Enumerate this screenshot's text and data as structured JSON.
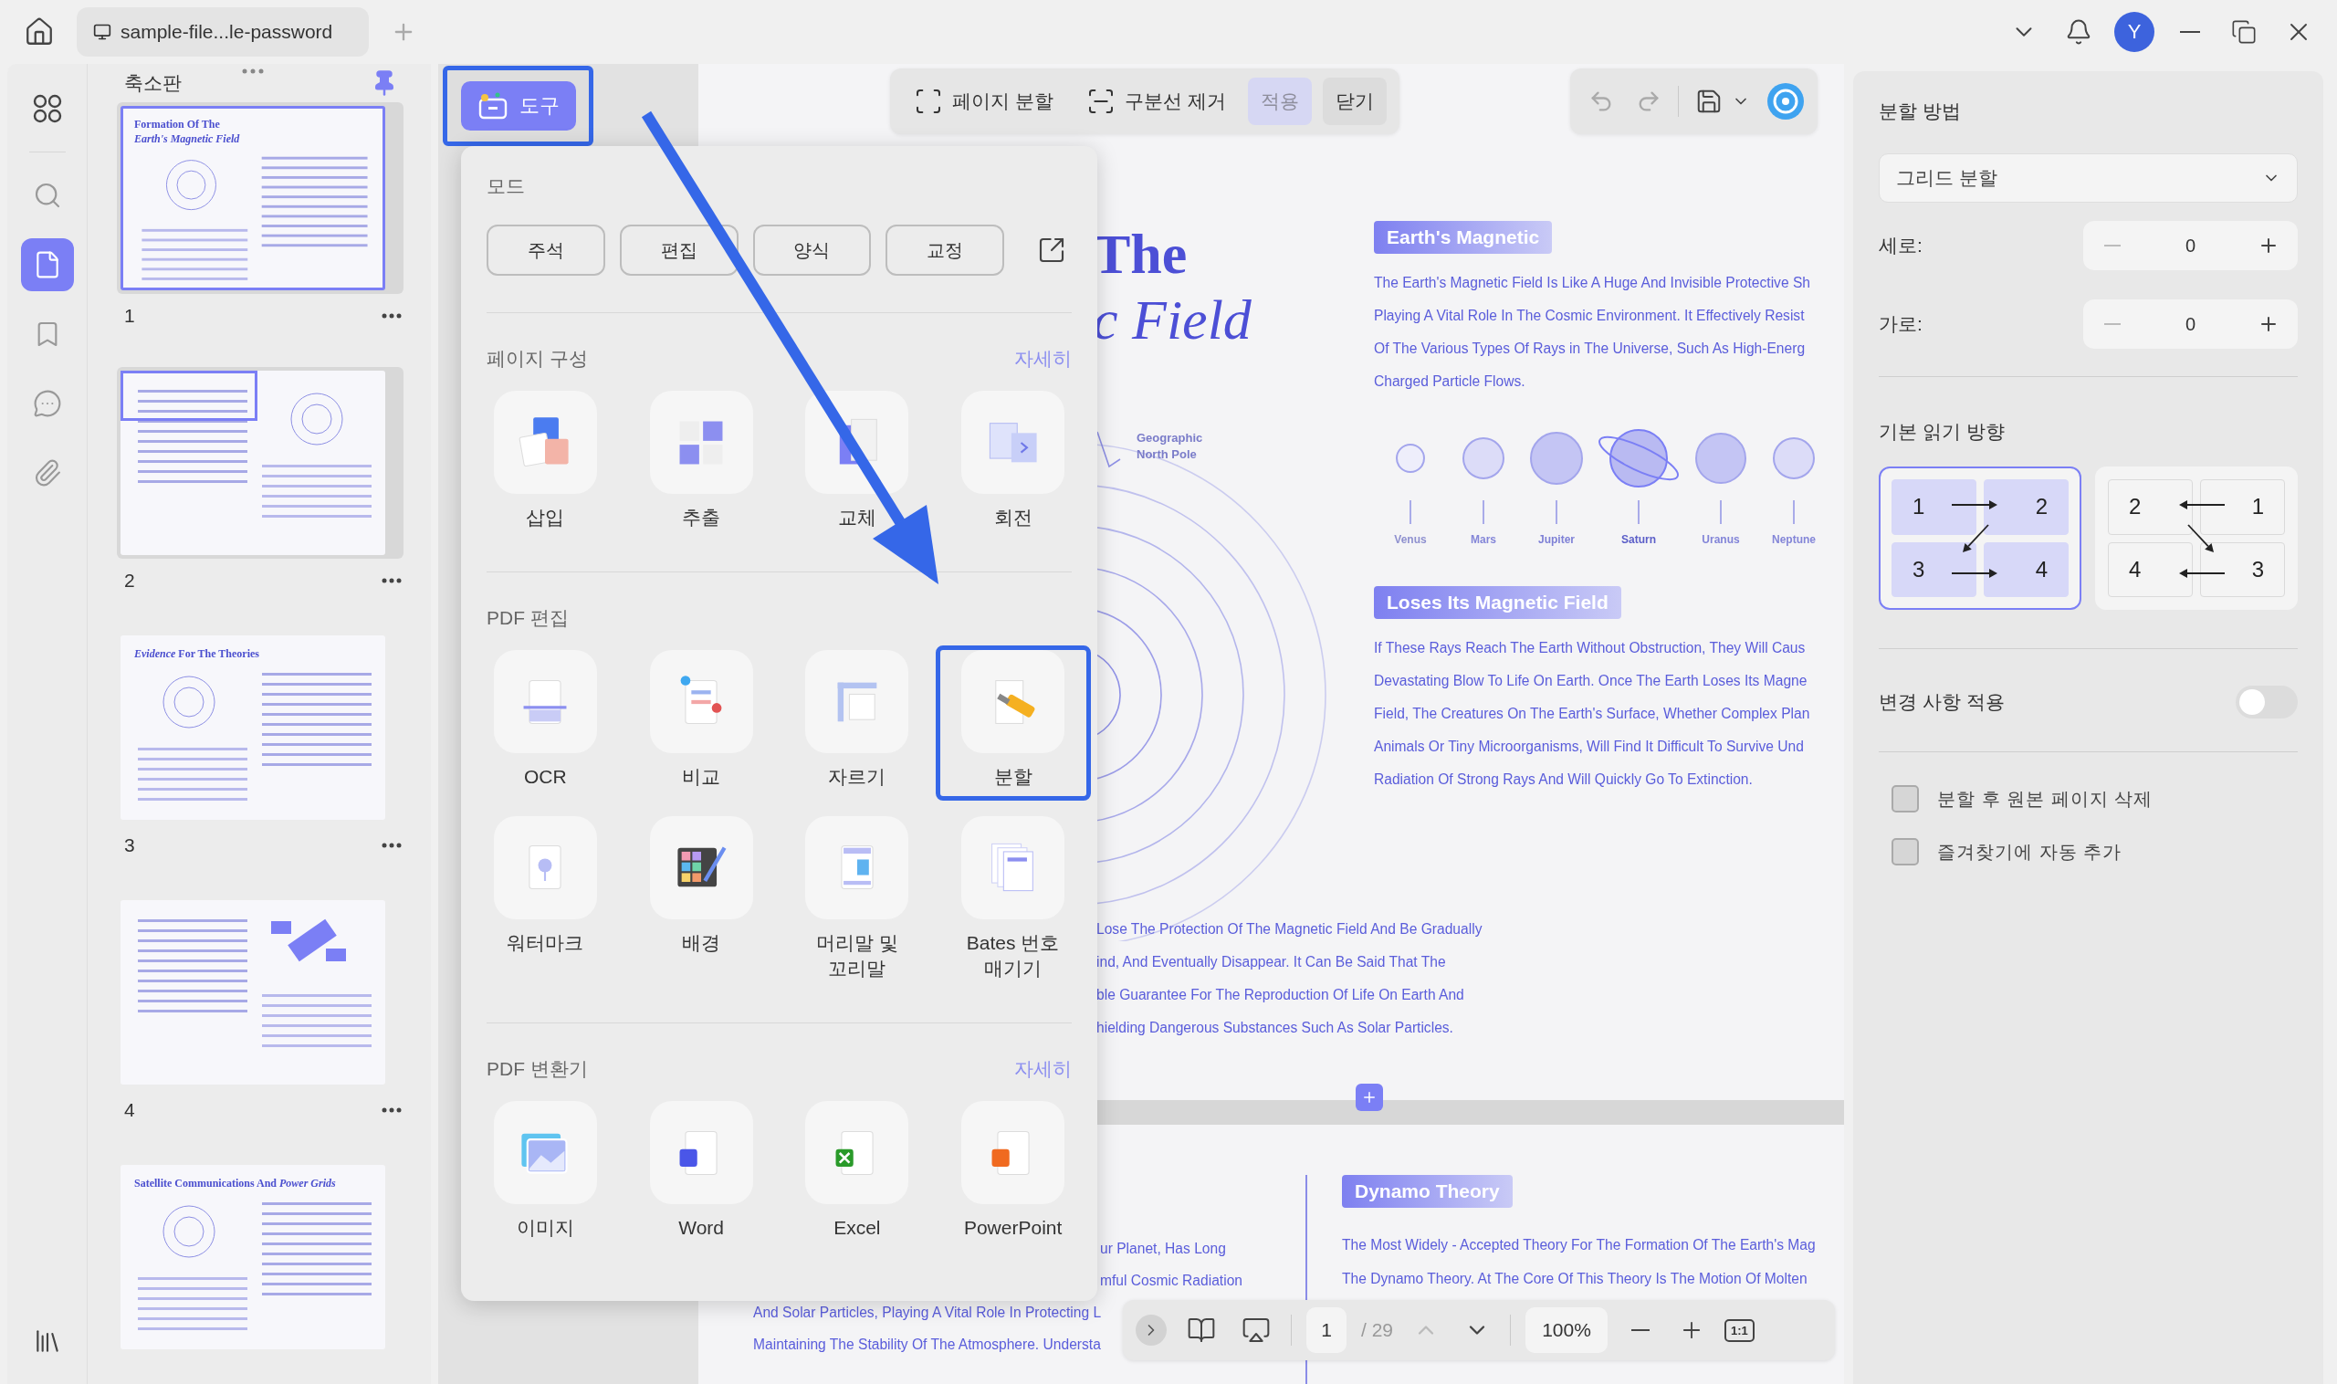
{
  "window": {
    "tab_title": "sample-file...le-password",
    "avatar": "Y"
  },
  "rail": [
    {
      "selected": false
    },
    {
      "selected": false
    },
    {
      "selected": true
    },
    {
      "selected": false
    },
    {
      "selected": false
    },
    {
      "selected": false
    }
  ],
  "thumbnails": {
    "title": "축소판",
    "pages": [
      {
        "number": "1",
        "title": "Formation Of The\n*Earth's Magnetic Field*",
        "selected": true,
        "in_view": true
      },
      {
        "number": "2",
        "selected": false,
        "in_view": true
      },
      {
        "number": "3",
        "title": "*Evidence* For The Theories",
        "selected": false,
        "in_view": false
      },
      {
        "number": "4",
        "selected": false,
        "in_view": false
      },
      {
        "title": "Satellite Communications And *Power Grids*",
        "selected": false,
        "in_view": false
      }
    ]
  },
  "tools_button": {
    "label": "도구",
    "annotated": true
  },
  "toolbar": {
    "actions": [
      {
        "label": "페이지 분할"
      },
      {
        "label": "구분선 제거"
      }
    ],
    "buttons": [
      {
        "label": "적용",
        "disabled": true
      },
      {
        "label": "닫기",
        "disabled": false
      }
    ]
  },
  "tools_menu": {
    "mode_title": "모드",
    "modes": [
      "주석",
      "편집",
      "양식",
      "교정"
    ],
    "sections": [
      {
        "title": "페이지 구성",
        "more": "자세히",
        "tools": [
          {
            "label": "삽입",
            "annotated": false
          },
          {
            "label": "추출",
            "annotated": false
          },
          {
            "label": "교체",
            "annotated": false
          },
          {
            "label": "회전",
            "annotated": false
          }
        ]
      },
      {
        "title": "PDF 편집",
        "tools": [
          {
            "label": "OCR",
            "annotated": false
          },
          {
            "label": "비교",
            "annotated": false
          },
          {
            "label": "자르기",
            "annotated": false
          },
          {
            "label": "분할",
            "annotated": true
          },
          {
            "label": "워터마크",
            "annotated": false
          },
          {
            "label": "배경",
            "annotated": false
          },
          {
            "label": "머리말 및\n꼬리말",
            "annotated": false
          },
          {
            "label": "Bates 번호\n매기기",
            "annotated": false
          }
        ]
      },
      {
        "title": "PDF 변환기",
        "more": "자세히",
        "tools": [
          {
            "label": "이미지",
            "annotated": false
          },
          {
            "label": "Word",
            "annotated": false
          },
          {
            "label": "Excel",
            "annotated": false
          },
          {
            "label": "PowerPoint",
            "annotated": false
          }
        ]
      }
    ]
  },
  "document": {
    "page_1": {
      "title_lines": [
        "The",
        "c Field"
      ],
      "pole_label": "Geographic\nNorth Pole",
      "sections": [
        {
          "tag": "Earth's Magnetic",
          "text": "The Earth's Magnetic Field Is Like A Huge And Invisible Protective Sh\nPlaying A Vital Role In The Cosmic Environment. It Effectively Resist\nOf The Various Types Of Rays in The Universe, Such As High-Energ\nCharged Particle Flows."
        },
        {
          "tag": "Loses Its Magnetic Field",
          "text": "If These Rays Reach The Earth Without Obstruction, They Will Caus\nDevastating Blow To Life On Earth. Once The Earth Loses Its Magne\nField, The Creatures On The Earth's Surface, Whether Complex Plan\nAnimals Or Tiny Microorganisms, Will Find It Difficult To Survive Und\nRadiation Of Strong Rays And Will Quickly Go To Extinction."
        }
      ],
      "planets": [
        {
          "name": "Venus",
          "kind": "plain"
        },
        {
          "name": "Mars",
          "kind": "plain"
        },
        {
          "name": "Jupiter",
          "kind": "plain"
        },
        {
          "name": "Saturn",
          "kind": "ringed"
        },
        {
          "name": "Uranus",
          "kind": "plain"
        },
        {
          "name": "Neptune",
          "kind": "plain"
        }
      ],
      "bottom_text": "Lose The Protection Of The Magnetic Field And Be Gradually\nind, And Eventually Disappear. It Can Be Said That The\nble Guarantee For The Reproduction Of Life On Earth And\nhielding Dangerous Substances Such As Solar Particles."
    },
    "page_2": {
      "left_text_top": "ur Planet, Has Long\nmful Cosmic Radiation",
      "left_text_bottom": "And Solar Particles, Playing A Vital Role In Protecting L\nMaintaining The Stability Of The Atmosphere. Understa",
      "tag": "Dynamo Theory",
      "text": "The Most Widely - Accepted Theory For The Formation Of The Earth's Mag\nThe Dynamo Theory. At The Core Of This Theory Is The Motion Of Molten"
    }
  },
  "split_panel": {
    "method_title": "분할 방법",
    "method": "그리드 분할",
    "rows_label": "세로:",
    "rows": "0",
    "cols_label": "가로:",
    "cols": "0",
    "direction_title": "기본 읽기 방향",
    "directions": [
      {
        "kind": "left-to-right",
        "cells": [
          "1",
          "2",
          "3",
          "4"
        ],
        "selected": true
      },
      {
        "kind": "right-to-left",
        "cells": [
          "2",
          "1",
          "4",
          "3"
        ],
        "selected": false
      }
    ],
    "apply_label": "변경 사항 적용",
    "apply_on": false,
    "options": [
      {
        "label": "분할 후 원본 페이지 삭제",
        "checked": false
      },
      {
        "label": "즐겨찾기에 자동 추가",
        "checked": false
      }
    ]
  },
  "bottom_bar": {
    "page": "1",
    "total": "/ 29",
    "zoom": "100%",
    "actual_size": "1:1"
  }
}
